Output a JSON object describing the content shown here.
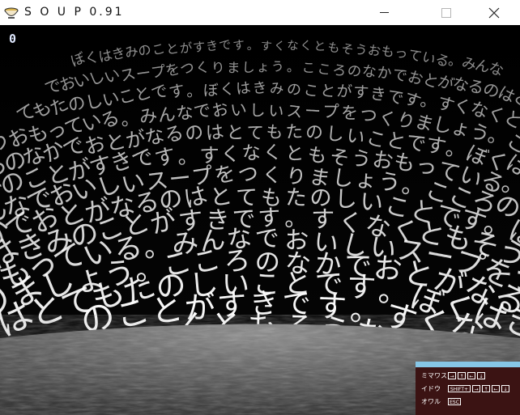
{
  "window": {
    "title": "S O U P 0.91",
    "controls": {
      "minimize_icon": "minimize-icon",
      "maximize_icon": "maximize-icon",
      "close_icon": "close-icon"
    }
  },
  "hud": {
    "counter": "0"
  },
  "scene": {
    "floating_text": "ぼくはきみのことがすきです。すくなくともそうおもっている。みんなでおいしいスープをつくりましょう。こころのなかでおとがなるのはとてもたのしいことです。",
    "text_color": "#ffffff",
    "floor_color": "#6c6c6c"
  },
  "help": {
    "rows": [
      {
        "label": "ミマワス",
        "keys": [
          "→",
          "↑",
          "←",
          "↓"
        ]
      },
      {
        "label": "イドウ",
        "keys": [
          "SHIFT+",
          "→",
          "↑",
          "←",
          "↓"
        ]
      },
      {
        "label": "オワル",
        "keys": [
          "ESC"
        ]
      }
    ],
    "accent_color": "#86c6e6",
    "panel_color": "#3b1313"
  }
}
